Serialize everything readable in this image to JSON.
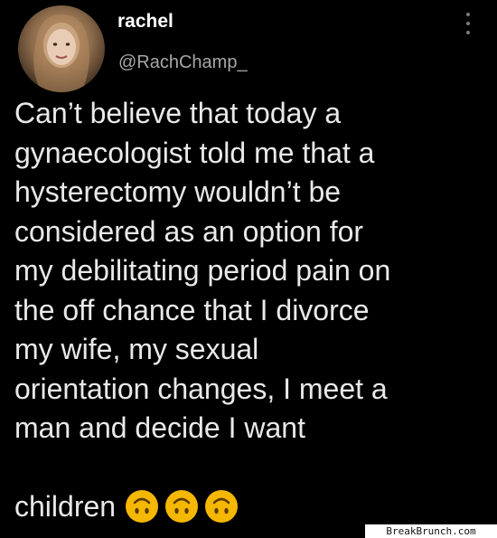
{
  "tweet": {
    "display_name": "rachel",
    "handle": "@RachChamp_",
    "text": "Can’t believe that today a\ngynaecologist told me that a\nhysterectomy wouldn’t be\nconsidered as an option for\nmy debilitating period pain on\nthe off chance that I divorce\nmy wife, my sexual\norientation changes, I meet a\nman and decide I want",
    "last_word": "children",
    "emojis": [
      "upside-down-face-icon",
      "upside-down-face-icon",
      "upside-down-face-icon"
    ],
    "emoji_color": "#f5b800"
  },
  "watermark": {
    "text": "BreakBrunch.com"
  },
  "colors": {
    "background": "#000000",
    "text": "#e9e9e9",
    "handle": "#a7a7a7"
  }
}
